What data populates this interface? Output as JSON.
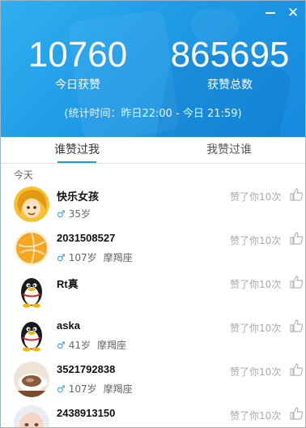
{
  "window": {
    "controls": {
      "minimize_icon": "minimize-icon",
      "close_label": "✕"
    }
  },
  "stats": {
    "today_count": "10760",
    "today_label": "今日获赞",
    "total_count": "865695",
    "total_label": "获赞总数",
    "period": "(统计时间：昨日22:00 - 今日 21:59)"
  },
  "tabs": [
    {
      "label": "谁赞过我",
      "active": true
    },
    {
      "label": "我赞过谁",
      "active": false
    }
  ],
  "section_label": "今天",
  "colors": {
    "header": "#1f9ae6",
    "accent": "#1b9be8",
    "male": "#2a9ae8"
  },
  "users": [
    {
      "name": "快乐女孩",
      "gender": "♂",
      "age": "35岁",
      "zodiac": "",
      "likes": "赞了你10次",
      "avatar": "cartoon-girl"
    },
    {
      "name": "2031508527",
      "gender": "♂",
      "age": "107岁",
      "zodiac": "摩羯座",
      "likes": "赞了你10次",
      "avatar": "orange-ball"
    },
    {
      "name": "Rt真",
      "gender": "",
      "age": "",
      "zodiac": "",
      "likes": "赞了你10次",
      "avatar": "qq-penguin"
    },
    {
      "name": "aska",
      "gender": "♂",
      "age": "41岁",
      "zodiac": "摩羯座",
      "likes": "赞了你10次",
      "avatar": "qq-penguin"
    },
    {
      "name": "3521792838",
      "gender": "♂",
      "age": "107岁",
      "zodiac": "摩羯座",
      "likes": "赞了你10次",
      "avatar": "coffee-cup"
    },
    {
      "name": "2438913150",
      "gender": "",
      "age": "",
      "zodiac": "",
      "likes": "赞了你10次",
      "avatar": "baby-photo"
    }
  ]
}
